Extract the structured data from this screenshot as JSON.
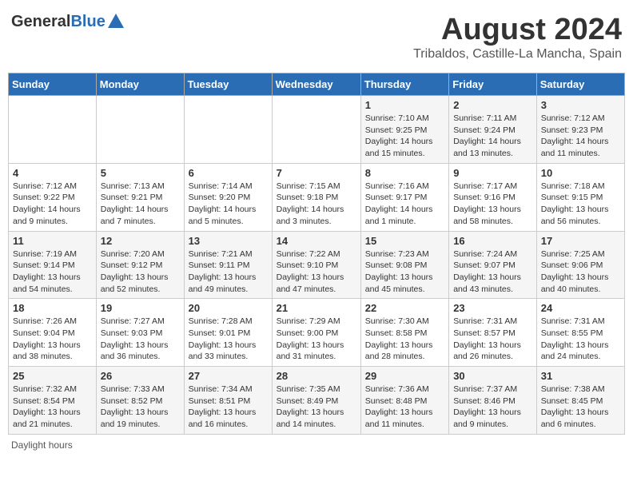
{
  "header": {
    "logo_general": "General",
    "logo_blue": "Blue",
    "main_title": "August 2024",
    "subtitle": "Tribaldos, Castille-La Mancha, Spain"
  },
  "columns": [
    "Sunday",
    "Monday",
    "Tuesday",
    "Wednesday",
    "Thursday",
    "Friday",
    "Saturday"
  ],
  "weeks": [
    [
      {
        "day": "",
        "info": ""
      },
      {
        "day": "",
        "info": ""
      },
      {
        "day": "",
        "info": ""
      },
      {
        "day": "",
        "info": ""
      },
      {
        "day": "1",
        "info": "Sunrise: 7:10 AM\nSunset: 9:25 PM\nDaylight: 14 hours\nand 15 minutes."
      },
      {
        "day": "2",
        "info": "Sunrise: 7:11 AM\nSunset: 9:24 PM\nDaylight: 14 hours\nand 13 minutes."
      },
      {
        "day": "3",
        "info": "Sunrise: 7:12 AM\nSunset: 9:23 PM\nDaylight: 14 hours\nand 11 minutes."
      }
    ],
    [
      {
        "day": "4",
        "info": "Sunrise: 7:12 AM\nSunset: 9:22 PM\nDaylight: 14 hours\nand 9 minutes."
      },
      {
        "day": "5",
        "info": "Sunrise: 7:13 AM\nSunset: 9:21 PM\nDaylight: 14 hours\nand 7 minutes."
      },
      {
        "day": "6",
        "info": "Sunrise: 7:14 AM\nSunset: 9:20 PM\nDaylight: 14 hours\nand 5 minutes."
      },
      {
        "day": "7",
        "info": "Sunrise: 7:15 AM\nSunset: 9:18 PM\nDaylight: 14 hours\nand 3 minutes."
      },
      {
        "day": "8",
        "info": "Sunrise: 7:16 AM\nSunset: 9:17 PM\nDaylight: 14 hours\nand 1 minute."
      },
      {
        "day": "9",
        "info": "Sunrise: 7:17 AM\nSunset: 9:16 PM\nDaylight: 13 hours\nand 58 minutes."
      },
      {
        "day": "10",
        "info": "Sunrise: 7:18 AM\nSunset: 9:15 PM\nDaylight: 13 hours\nand 56 minutes."
      }
    ],
    [
      {
        "day": "11",
        "info": "Sunrise: 7:19 AM\nSunset: 9:14 PM\nDaylight: 13 hours\nand 54 minutes."
      },
      {
        "day": "12",
        "info": "Sunrise: 7:20 AM\nSunset: 9:12 PM\nDaylight: 13 hours\nand 52 minutes."
      },
      {
        "day": "13",
        "info": "Sunrise: 7:21 AM\nSunset: 9:11 PM\nDaylight: 13 hours\nand 49 minutes."
      },
      {
        "day": "14",
        "info": "Sunrise: 7:22 AM\nSunset: 9:10 PM\nDaylight: 13 hours\nand 47 minutes."
      },
      {
        "day": "15",
        "info": "Sunrise: 7:23 AM\nSunset: 9:08 PM\nDaylight: 13 hours\nand 45 minutes."
      },
      {
        "day": "16",
        "info": "Sunrise: 7:24 AM\nSunset: 9:07 PM\nDaylight: 13 hours\nand 43 minutes."
      },
      {
        "day": "17",
        "info": "Sunrise: 7:25 AM\nSunset: 9:06 PM\nDaylight: 13 hours\nand 40 minutes."
      }
    ],
    [
      {
        "day": "18",
        "info": "Sunrise: 7:26 AM\nSunset: 9:04 PM\nDaylight: 13 hours\nand 38 minutes."
      },
      {
        "day": "19",
        "info": "Sunrise: 7:27 AM\nSunset: 9:03 PM\nDaylight: 13 hours\nand 36 minutes."
      },
      {
        "day": "20",
        "info": "Sunrise: 7:28 AM\nSunset: 9:01 PM\nDaylight: 13 hours\nand 33 minutes."
      },
      {
        "day": "21",
        "info": "Sunrise: 7:29 AM\nSunset: 9:00 PM\nDaylight: 13 hours\nand 31 minutes."
      },
      {
        "day": "22",
        "info": "Sunrise: 7:30 AM\nSunset: 8:58 PM\nDaylight: 13 hours\nand 28 minutes."
      },
      {
        "day": "23",
        "info": "Sunrise: 7:31 AM\nSunset: 8:57 PM\nDaylight: 13 hours\nand 26 minutes."
      },
      {
        "day": "24",
        "info": "Sunrise: 7:31 AM\nSunset: 8:55 PM\nDaylight: 13 hours\nand 24 minutes."
      }
    ],
    [
      {
        "day": "25",
        "info": "Sunrise: 7:32 AM\nSunset: 8:54 PM\nDaylight: 13 hours\nand 21 minutes."
      },
      {
        "day": "26",
        "info": "Sunrise: 7:33 AM\nSunset: 8:52 PM\nDaylight: 13 hours\nand 19 minutes."
      },
      {
        "day": "27",
        "info": "Sunrise: 7:34 AM\nSunset: 8:51 PM\nDaylight: 13 hours\nand 16 minutes."
      },
      {
        "day": "28",
        "info": "Sunrise: 7:35 AM\nSunset: 8:49 PM\nDaylight: 13 hours\nand 14 minutes."
      },
      {
        "day": "29",
        "info": "Sunrise: 7:36 AM\nSunset: 8:48 PM\nDaylight: 13 hours\nand 11 minutes."
      },
      {
        "day": "30",
        "info": "Sunrise: 7:37 AM\nSunset: 8:46 PM\nDaylight: 13 hours\nand 9 minutes."
      },
      {
        "day": "31",
        "info": "Sunrise: 7:38 AM\nSunset: 8:45 PM\nDaylight: 13 hours\nand 6 minutes."
      }
    ]
  ],
  "footer": {
    "daylight_label": "Daylight hours"
  }
}
